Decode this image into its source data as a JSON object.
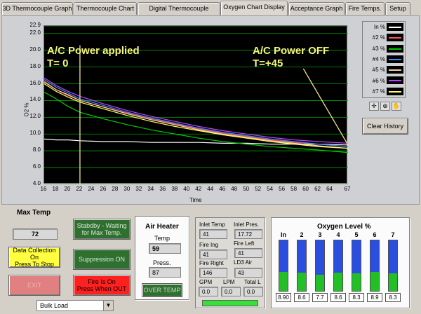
{
  "tabs": [
    {
      "label": "3D Thermocouple Graph"
    },
    {
      "label": "Thermocouple Chart"
    },
    {
      "label": "Digital Thermocouple Display"
    },
    {
      "label": "Oxygen Chart Display"
    },
    {
      "label": "Acceptance Graph"
    },
    {
      "label": "Fire Temps."
    },
    {
      "label": "Setup"
    }
  ],
  "active_tab": "Oxygen Chart Display",
  "chart_data": {
    "type": "line",
    "xlabel": "Time",
    "ylabel": "O2 %",
    "xlim": [
      16,
      67
    ],
    "ylim": [
      4.0,
      22.9
    ],
    "xticks": [
      16,
      18,
      20,
      22,
      24,
      26,
      28,
      30,
      32,
      34,
      36,
      38,
      40,
      42,
      44,
      46,
      48,
      50,
      52,
      54,
      56,
      58,
      60,
      62,
      64,
      67
    ],
    "yticks": [
      "22.9",
      "22.0",
      "20.0",
      "18.0",
      "16.0",
      "14.0",
      "12.0",
      "10.0",
      "8.0",
      "6.0",
      "4.0"
    ],
    "grid": true,
    "legend_position": "right",
    "annotations": [
      {
        "text": "A/C Power applied",
        "x": 22
      },
      {
        "text": "T= 0"
      },
      {
        "text": "A/C Power OFF",
        "x": 67
      },
      {
        "text": "T=+45"
      }
    ],
    "series": [
      {
        "name": "In %",
        "color": "#ffffff",
        "x": [
          16,
          18,
          20,
          22,
          26,
          30,
          34,
          38,
          42,
          46,
          50,
          54,
          58,
          62,
          67
        ],
        "values": [
          9.4,
          9.3,
          9.3,
          9.2,
          9.1,
          9.1,
          9.0,
          9.0,
          9.0,
          8.9,
          8.9,
          8.8,
          8.8,
          8.8,
          8.7
        ]
      },
      {
        "name": "#2 %",
        "color": "#ff5050",
        "x": [
          16,
          18,
          20,
          22,
          26,
          30,
          34,
          38,
          42,
          46,
          50,
          54,
          58,
          62,
          67
        ],
        "values": [
          16.3,
          15.3,
          14.6,
          14.0,
          13.2,
          12.5,
          11.8,
          11.2,
          10.6,
          10.1,
          9.7,
          9.3,
          9.0,
          8.8,
          8.5
        ]
      },
      {
        "name": "#3 %",
        "color": "#00d000",
        "x": [
          16,
          18,
          20,
          22,
          26,
          30,
          34,
          38,
          42,
          46,
          50,
          54,
          58,
          62,
          67
        ],
        "values": [
          15.0,
          14.2,
          13.3,
          12.6,
          11.8,
          11.1,
          10.5,
          10.0,
          9.5,
          9.1,
          8.8,
          8.5,
          8.3,
          8.1,
          7.8
        ]
      },
      {
        "name": "#4 %",
        "color": "#3a8cff",
        "x": [
          16,
          18,
          20,
          22,
          26,
          30,
          34,
          38,
          42,
          46,
          50,
          54,
          58,
          62,
          67
        ],
        "values": [
          16.5,
          15.6,
          14.9,
          14.2,
          13.4,
          12.6,
          11.9,
          11.3,
          10.7,
          10.2,
          9.8,
          9.4,
          9.1,
          8.8,
          8.5
        ]
      },
      {
        "name": "#5 %",
        "color": "#ffd0a0",
        "x": [
          16,
          18,
          20,
          22,
          26,
          30,
          34,
          38,
          42,
          46,
          50,
          54,
          58,
          62,
          67
        ],
        "values": [
          16.2,
          15.3,
          14.7,
          14.0,
          13.2,
          12.4,
          11.7,
          11.1,
          10.5,
          10.0,
          9.6,
          9.2,
          8.9,
          8.6,
          8.3
        ]
      },
      {
        "name": "#6 %",
        "color": "#c040ff",
        "x": [
          16,
          18,
          20,
          22,
          26,
          30,
          34,
          38,
          42,
          46,
          50,
          54,
          58,
          62,
          67
        ],
        "values": [
          16.7,
          15.8,
          15.1,
          14.5,
          13.6,
          12.8,
          12.1,
          11.5,
          10.9,
          10.4,
          10.0,
          9.6,
          9.3,
          9.1,
          8.9
        ]
      },
      {
        "name": "#7 %",
        "color": "#ffff60",
        "x": [
          16,
          18,
          20,
          22,
          26,
          30,
          34,
          38,
          42,
          46,
          50,
          54,
          58,
          62,
          67
        ],
        "values": [
          16.0,
          15.1,
          14.4,
          13.8,
          13.0,
          12.2,
          11.5,
          10.9,
          10.4,
          9.9,
          9.5,
          9.1,
          8.8,
          8.5,
          8.3
        ]
      }
    ]
  },
  "colors": {
    "cursor_line": "#f0e68c",
    "plot_bg": "#000000",
    "grid": "#00a000"
  },
  "legend_tools": {
    "icons": [
      "crosshair-icon",
      "zoom-icon",
      "hand-icon"
    ]
  },
  "clear_history_label": "Clear History",
  "max_temp": {
    "label": "Max Temp",
    "value": "72"
  },
  "buttons": {
    "data_collection": "Data Collection On\nPress To Stop",
    "exit": "EXIT",
    "standby": "Stabdby - Waiting\nfor Max Temp.",
    "suppression": "Suppression ON",
    "fire": "Fire Is On\nPress When OUT"
  },
  "colors_buttons": {
    "data_collection": "#ffff40",
    "exit": "#e08080",
    "standby": "#2f6f2f",
    "suppression": "#2f6f2f",
    "fire": "#ff2020"
  },
  "air_heater": {
    "title": "Air Heater",
    "temp_label": "Temp",
    "temp_value": "59",
    "press_label": "Press.",
    "press_value": "87",
    "over_temp_label": "OVER TEMP"
  },
  "inlet": {
    "inlet_temp_label": "Inlet Temp",
    "inlet_temp_value": "41",
    "inlet_pres_label": "Inlet Pres.",
    "inlet_pres_value": "17.72",
    "fire_ing_label": "Fire Ing",
    "fire_ing_value": "41",
    "fire_left_label": "Fire Left",
    "fire_left_value": "41",
    "fire_right_label": "Fire Right",
    "fire_right_value": "146",
    "ld3_air_label": "LD3 Air",
    "ld3_air_value": "43",
    "gpm_label": "GPM",
    "gpm_value": "0.0",
    "lpm_label": "LPM",
    "lpm_value": "0.0",
    "total_label": "Total L",
    "total_value": "0.0",
    "progress_fraction": 1.0
  },
  "oxygen": {
    "title": "Oxygen Level %",
    "bars": [
      {
        "label": "In",
        "value": "8.90",
        "fill_fraction": 0.38
      },
      {
        "label": "2",
        "value": "8.6",
        "fill_fraction": 0.36
      },
      {
        "label": "3",
        "value": "7.7",
        "fill_fraction": 0.32
      },
      {
        "label": "4",
        "value": "8.6",
        "fill_fraction": 0.36
      },
      {
        "label": "5",
        "value": "8.3",
        "fill_fraction": 0.35
      },
      {
        "label": "6",
        "value": "8.9",
        "fill_fraction": 0.37
      },
      {
        "label": "7",
        "value": "8.3",
        "fill_fraction": 0.35
      }
    ]
  },
  "bulk_load": {
    "selected": "Bulk Load"
  }
}
